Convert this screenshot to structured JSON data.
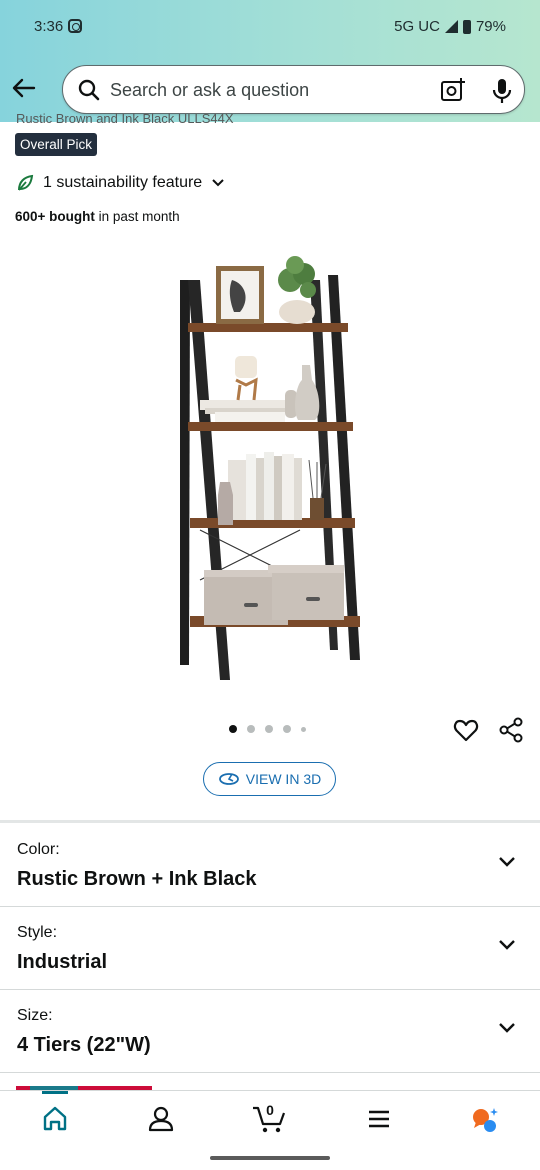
{
  "status_bar": {
    "time": "3:36",
    "network": "5G UC",
    "battery": "79%"
  },
  "search": {
    "placeholder": "Search or ask a question"
  },
  "product": {
    "title_partial": "Rustic Brown and Ink Black ULLS44X",
    "badge": "Overall Pick",
    "sustainability": "1 sustainability feature",
    "bought_bold": "600+ bought",
    "bought_rest": " in past month",
    "image_count": 5,
    "active_image": 1
  },
  "view_3d": {
    "label": "VIEW IN 3D"
  },
  "options": [
    {
      "label": "Color:",
      "value": "Rustic Brown + Ink Black"
    },
    {
      "label": "Style:",
      "value": "Industrial"
    },
    {
      "label": "Size:",
      "value": "4 Tiers (22\"W)"
    }
  ],
  "bottom_nav": {
    "cart_count": "0"
  },
  "colors": {
    "accent_link": "#1a6eb0",
    "badge_bg": "#232f3e",
    "teal": "#007185",
    "header_from": "#86d3dc",
    "header_to": "#b6e6cf"
  }
}
